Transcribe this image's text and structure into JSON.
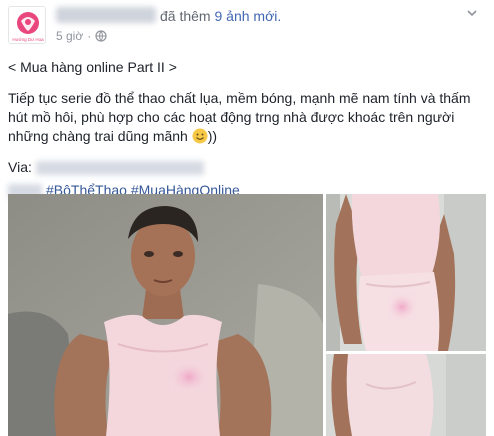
{
  "post": {
    "action_text": "đã thêm",
    "photo_count_text": "9 ảnh mới.",
    "timestamp": "5 giờ",
    "dot": "·",
    "title_line": "< Mua hàng online Part II >",
    "body_line1": "Tiếp tục serie đồ thể thao chất lụa, mềm bóng, mạnh mẽ nam tính và thấm",
    "body_line2": "hút mồ hôi, phù hợp cho các hoạt động trng nhà được khoác trên người",
    "body_line3": "những chàng trai dũng mãnh",
    "body_line3_end": "))",
    "via_label": "Via:",
    "hashtag1": "#BộThểThao",
    "hashtag2": "#MuaHàngOnline",
    "avatar_label": "Hướng Dư Hoa"
  },
  "icons": {
    "globe": "globe-icon",
    "more": "chevron-down-icon",
    "emoji": "smile-emoji-icon"
  },
  "colors": {
    "link": "#365899",
    "meta": "#90949c",
    "accent_pink": "#e8467c",
    "shirt_pink": "#f3d7dc"
  }
}
